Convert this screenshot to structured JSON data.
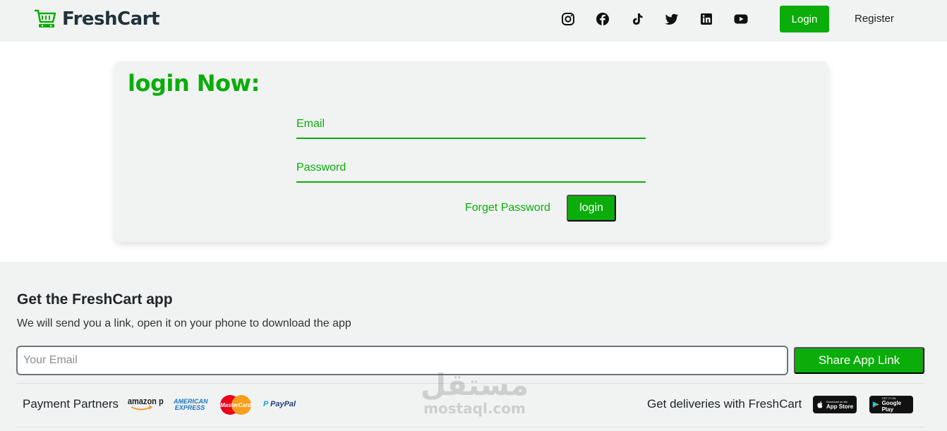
{
  "navbar": {
    "brand": "FreshCart",
    "socials": [
      "instagram-icon",
      "facebook-icon",
      "tiktok-icon",
      "twitter-icon",
      "linkedin-icon",
      "youtube-icon"
    ],
    "login_label": "Login",
    "register_label": "Register"
  },
  "login_form": {
    "title": "login Now:",
    "email_placeholder": "Email",
    "password_placeholder": "Password",
    "forget_label": "Forget Password",
    "submit_label": "login"
  },
  "footer": {
    "title": "Get the FreshCart app",
    "subtitle": "We will send you a link, open it on your phone to download the app",
    "email_placeholder": "Your Email",
    "share_label": "Share App Link",
    "partners_label": "Payment Partners",
    "partners": [
      "amazon pay",
      "AMERICAN EXPRESS",
      "MasterCard",
      "PayPal"
    ],
    "deliveries_label": "Get deliveries with FreshCart",
    "stores": [
      {
        "small": "Download on the",
        "big": "App Store"
      },
      {
        "small": "GET IT ON",
        "big": "Google Play"
      }
    ]
  },
  "watermark": {
    "arabic": "مستقل",
    "latin": "mostaql.com"
  },
  "colors": {
    "brand_green": "#0aad0a",
    "panel_bg": "#f0f3f2",
    "dark_text": "#21313c"
  }
}
